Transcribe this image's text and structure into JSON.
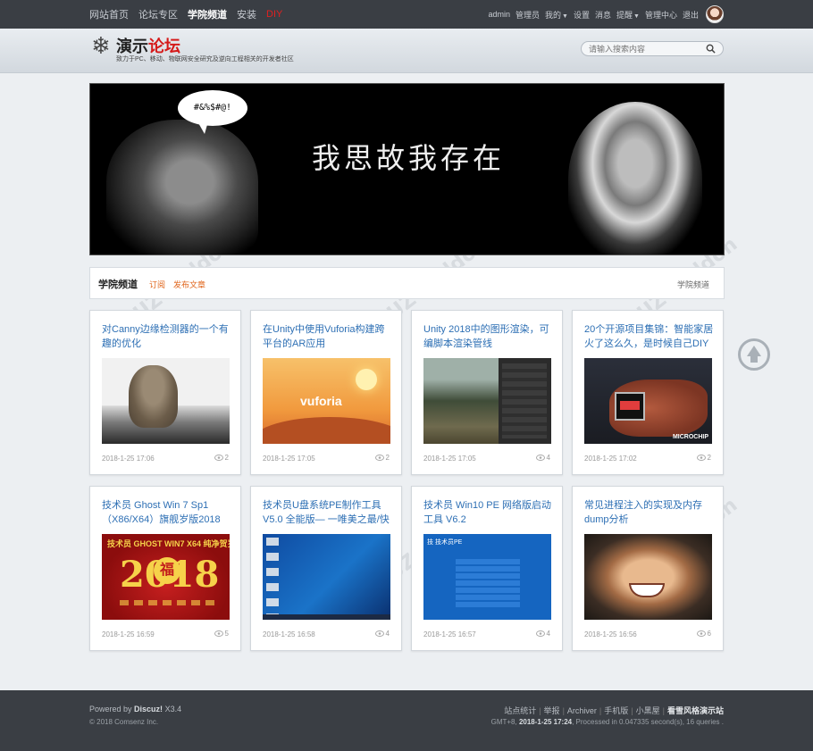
{
  "topbar": {
    "nav": [
      {
        "label": "网站首页",
        "name": "nav-home",
        "active": false
      },
      {
        "label": "论坛专区",
        "name": "nav-forum",
        "active": false
      },
      {
        "label": "学院频道",
        "name": "nav-academy",
        "active": true
      },
      {
        "label": "安装",
        "name": "nav-install",
        "active": false
      },
      {
        "label": "DIY",
        "name": "nav-diy",
        "active": false
      }
    ],
    "user": {
      "username": "admin",
      "admin_label": "管理员",
      "mine_label": "我的",
      "settings_label": "设置",
      "messages_label": "消息",
      "notify_label": "提醒",
      "admin_center_label": "管理中心",
      "logout_label": "退出"
    }
  },
  "header": {
    "logo_part1": "演示",
    "logo_part2": "论坛",
    "slogan": "致力于PC、移动、物联网安全研究及逆向工程相关的开发者社区",
    "search_placeholder": "请输入搜索内容"
  },
  "banner": {
    "bubble_text": "#&%$#@!",
    "headline": "我思故我存在"
  },
  "section": {
    "title": "学院频道",
    "subscribe_label": "订阅",
    "publish_label": "发布文章",
    "breadcrumb": "学院频道"
  },
  "articles": [
    {
      "title": "对Canny边缘检测器的一个有趣的优化",
      "date": "2018-1-25 17:06",
      "views": "2"
    },
    {
      "title": "在Unity中使用Vuforia构建跨平台的AR应用",
      "date": "2018-1-25 17:05",
      "views": "2"
    },
    {
      "title": "Unity 2018中的图形渲染，可编脚本渲染管线",
      "date": "2018-1-25 17:05",
      "views": "4"
    },
    {
      "title": "20个开源项目集锦：智能家居火了这么久，是时候自己DIY了",
      "date": "2018-1-25 17:02",
      "views": "2"
    },
    {
      "title": "技术员 Ghost Win 7 Sp1（X86/X64）旗舰岁版2018",
      "date": "2018-1-25 16:59",
      "views": "5"
    },
    {
      "title": "技术员U盘系统PE制作工具 V5.0 全能版— 一唯美之最/快稳",
      "date": "2018-1-25 16:58",
      "views": "4"
    },
    {
      "title": "技术员 Win10 PE 网络版启动工具 V6.2",
      "date": "2018-1-25 16:57",
      "views": "4"
    },
    {
      "title": "常见进程注入的实现及内存dump分析",
      "date": "2018-1-25 16:56",
      "views": "6"
    }
  ],
  "thumb_text": {
    "vuforia": "vuforia",
    "ghost_top": "技术员 GHOST WIN7 X64 纯净贺岁版",
    "ghost_year": "2018",
    "ghost_fu": "福",
    "win10_head": "技 技术员PE",
    "watch_brand": "MICROCHIP"
  },
  "footer": {
    "powered_prefix": "Powered by",
    "powered_brand": "Discuz!",
    "powered_version": "X3.4",
    "copyright": "© 2018 Comsenz Inc.",
    "links": [
      "站点统计",
      "举报",
      "Archiver",
      "手机版",
      "小黑屋"
    ],
    "style_link": "看雪风格演示站",
    "stats_prefix": "GMT+8,",
    "stats_time": "2018-1-25 17:24",
    "stats_suffix": ", Processed in 0.047335 second(s), 16 queries ."
  },
  "icons": {
    "search": "search-icon",
    "views": "eye-icon",
    "back_to_top": "arrow-up-icon",
    "logo": "snowflake-icon"
  },
  "colors": {
    "topbar_bg": "#3a3e44",
    "link_blue": "#2d6fb4",
    "accent_orange": "#e0651b",
    "logo_red": "#d51a1a",
    "diy_red": "#e02020"
  }
}
